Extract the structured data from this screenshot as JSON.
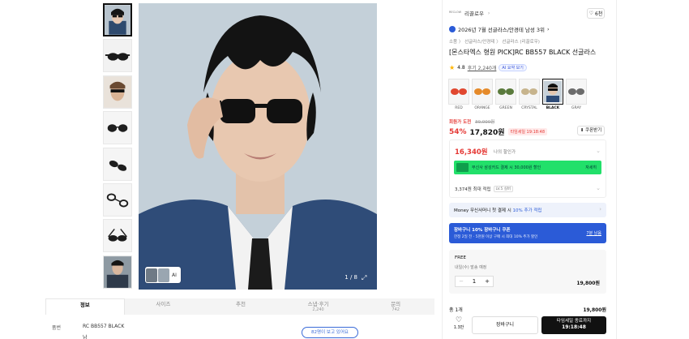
{
  "gallery": {
    "counter": "1 / 8",
    "ai_chip_label": "AI"
  },
  "tabs": [
    {
      "label": "정보",
      "sub": ""
    },
    {
      "label": "사이즈",
      "sub": ""
    },
    {
      "label": "추천",
      "sub": ""
    },
    {
      "label": "스냅·후기",
      "sub": "2,240"
    },
    {
      "label": "문의",
      "sub": "742"
    }
  ],
  "info": {
    "row_label": "품번",
    "row_value": "RC BB557 BLACK",
    "row2_value": "남",
    "view_pill": "82명이 보고 있어요"
  },
  "product": {
    "brand_logo": "RECLOW",
    "brand": "리끌로우",
    "likes": "6천",
    "rank": "2026년 7월 선글라스/안경테 남성 3위",
    "breadcrumb": "소품  〉 선글라스/안경테  〉 선글라스 (리끌로우)",
    "title": "[몬스타엑스 형원 PICK]RC BB557 BLACK 선글라스",
    "rating": "4.8",
    "reviews": "후기 2,240개",
    "ai_review": "AI 요약 보기"
  },
  "swatches": [
    {
      "label": "RED",
      "color": "#e0472f"
    },
    {
      "label": "ORANGE",
      "color": "#e58a2a"
    },
    {
      "label": "GREEN",
      "color": "#5a7a3c"
    },
    {
      "label": "CRYSTAL",
      "color": "#c7b48d"
    },
    {
      "label": "BLACK",
      "color": "#111111"
    },
    {
      "label": "GRAY",
      "color": "#6b6b6b"
    }
  ],
  "pricing": {
    "hot_label": "회원가 도전",
    "original": "39,000원",
    "discount": "54%",
    "price": "17,820원",
    "timer": "타임세일 19:18:48",
    "coupon_btn": "쿠폰받기",
    "my_price": "16,340원",
    "my_price_label": "나의 할인가",
    "card_promo": "무신사 삼성카드 결제 시 30,000원 할인",
    "card_promo_btn": "자세히",
    "points": "3,374원 최대 적립",
    "level": "LV.5 실버",
    "money_text": "Money 무신사머니 첫 결제 시",
    "money_blue": "10% 추가 적립",
    "banner_title": "장바구니 10% 장바구니 쿠폰",
    "banner_sub": "한정 2일 전 · 5천원 이상 구매 시 최대 10% 추가 할인",
    "banner_link": "7분 남음"
  },
  "option": {
    "free": "FREE",
    "ship": "내일(수) 발송 예정",
    "qty": "1",
    "subtotal": "19,800원"
  },
  "total": {
    "label": "총 1개",
    "value": "19,800원",
    "heart_count": "1.3만",
    "cart": "장바구니",
    "buy_top": "타임세일 종료까지",
    "buy_time": "19:18:48"
  }
}
